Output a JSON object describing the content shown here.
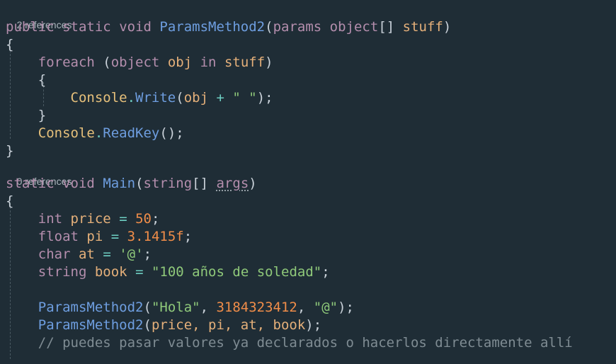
{
  "editor": {
    "background": "#1f2d36",
    "method1": {
      "references": "2 references",
      "kw_public": "public",
      "kw_static": "static",
      "kw_void": "void",
      "name": "ParamsMethod2",
      "open_paren": "(",
      "kw_params": "params",
      "kw_object": "object",
      "brackets": "[]",
      "param": "stuff",
      "close_paren": ")",
      "open_brace": "{",
      "foreach_kw": "foreach",
      "foreach_open": " (",
      "foreach_type": "object",
      "foreach_var": "obj",
      "foreach_in": "in",
      "foreach_coll": "stuff",
      "foreach_close": ")",
      "inner_open_brace": "{",
      "write_class": "Console",
      "dot": ".",
      "write_method": "Write",
      "write_open": "(",
      "write_arg": "obj",
      "plus": "+",
      "space_str": "\" \"",
      "write_close": ");",
      "inner_close_brace": "}",
      "readkey_class": "Console",
      "readkey_method": "ReadKey",
      "readkey_call": "();",
      "close_brace": "}"
    },
    "method2": {
      "references": "0 references",
      "kw_static": "static",
      "kw_void": "void",
      "name": "Main",
      "open_paren": "(",
      "kw_string": "string",
      "brackets": "[]",
      "param": "args",
      "close_paren": ")",
      "open_brace": "{",
      "int_kw": "int",
      "price_var": "price",
      "eq": "=",
      "price_val": "50",
      "semi": ";",
      "float_kw": "float",
      "pi_var": "pi",
      "pi_val": "3.1415f",
      "char_kw": "char",
      "at_var": "at",
      "at_val": "'@'",
      "string_kw": "string",
      "book_var": "book",
      "book_val": "\"100 años de soledad\"",
      "call1_name": "ParamsMethod2",
      "call1_open": "(",
      "call1_arg1": "\"Hola\"",
      "comma": ", ",
      "call1_arg2": "3184323412",
      "call1_arg3": "\"@\"",
      "call1_close": ");",
      "call2_name": "ParamsMethod2",
      "call2_open": "(",
      "call2_args": "price, pi, at, book",
      "call2_close": ");",
      "comment": "// puedes pasar valores ya declarados o hacerlos directamente allí"
    }
  }
}
